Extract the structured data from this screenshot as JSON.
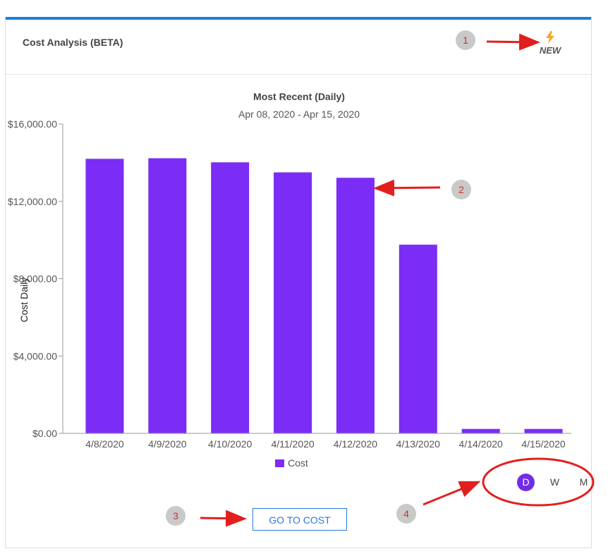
{
  "card": {
    "title": "Cost Analysis (BETA)",
    "new_label": "NEW",
    "accent_color": "#1a7fe0",
    "bolt_color": "#f5a623"
  },
  "chart_data": {
    "type": "bar",
    "title": "Most Recent (Daily)",
    "subtitle": "Apr 08, 2020 - Apr 15, 2020",
    "ylabel": "Cost Daily",
    "xlabel": "",
    "categories": [
      "4/8/2020",
      "4/9/2020",
      "4/10/2020",
      "4/11/2020",
      "4/12/2020",
      "4/13/2020",
      "4/14/2020",
      "4/15/2020"
    ],
    "series": [
      {
        "name": "Cost",
        "color": "#7b2cf5",
        "values": [
          14200,
          14230,
          14020,
          13500,
          13220,
          9760,
          230,
          230
        ]
      }
    ],
    "ylim": [
      0,
      16000
    ],
    "yticks": [
      0,
      4000,
      8000,
      12000,
      16000
    ],
    "ytick_labels": [
      "$0.00",
      "$4,000.00",
      "$8,000.00",
      "$12,000.00",
      "$16,000.00"
    ],
    "grid": false,
    "legend_position": "bottom-center"
  },
  "legend": {
    "label": "Cost"
  },
  "period_toggle": {
    "options": [
      "D",
      "W",
      "M"
    ],
    "active": "D",
    "active_color": "#6f2ee6"
  },
  "go_button": {
    "label": "GO TO COST"
  },
  "annotations": {
    "markers": [
      "1",
      "2",
      "3",
      "4"
    ],
    "color": "#e31e1e"
  }
}
